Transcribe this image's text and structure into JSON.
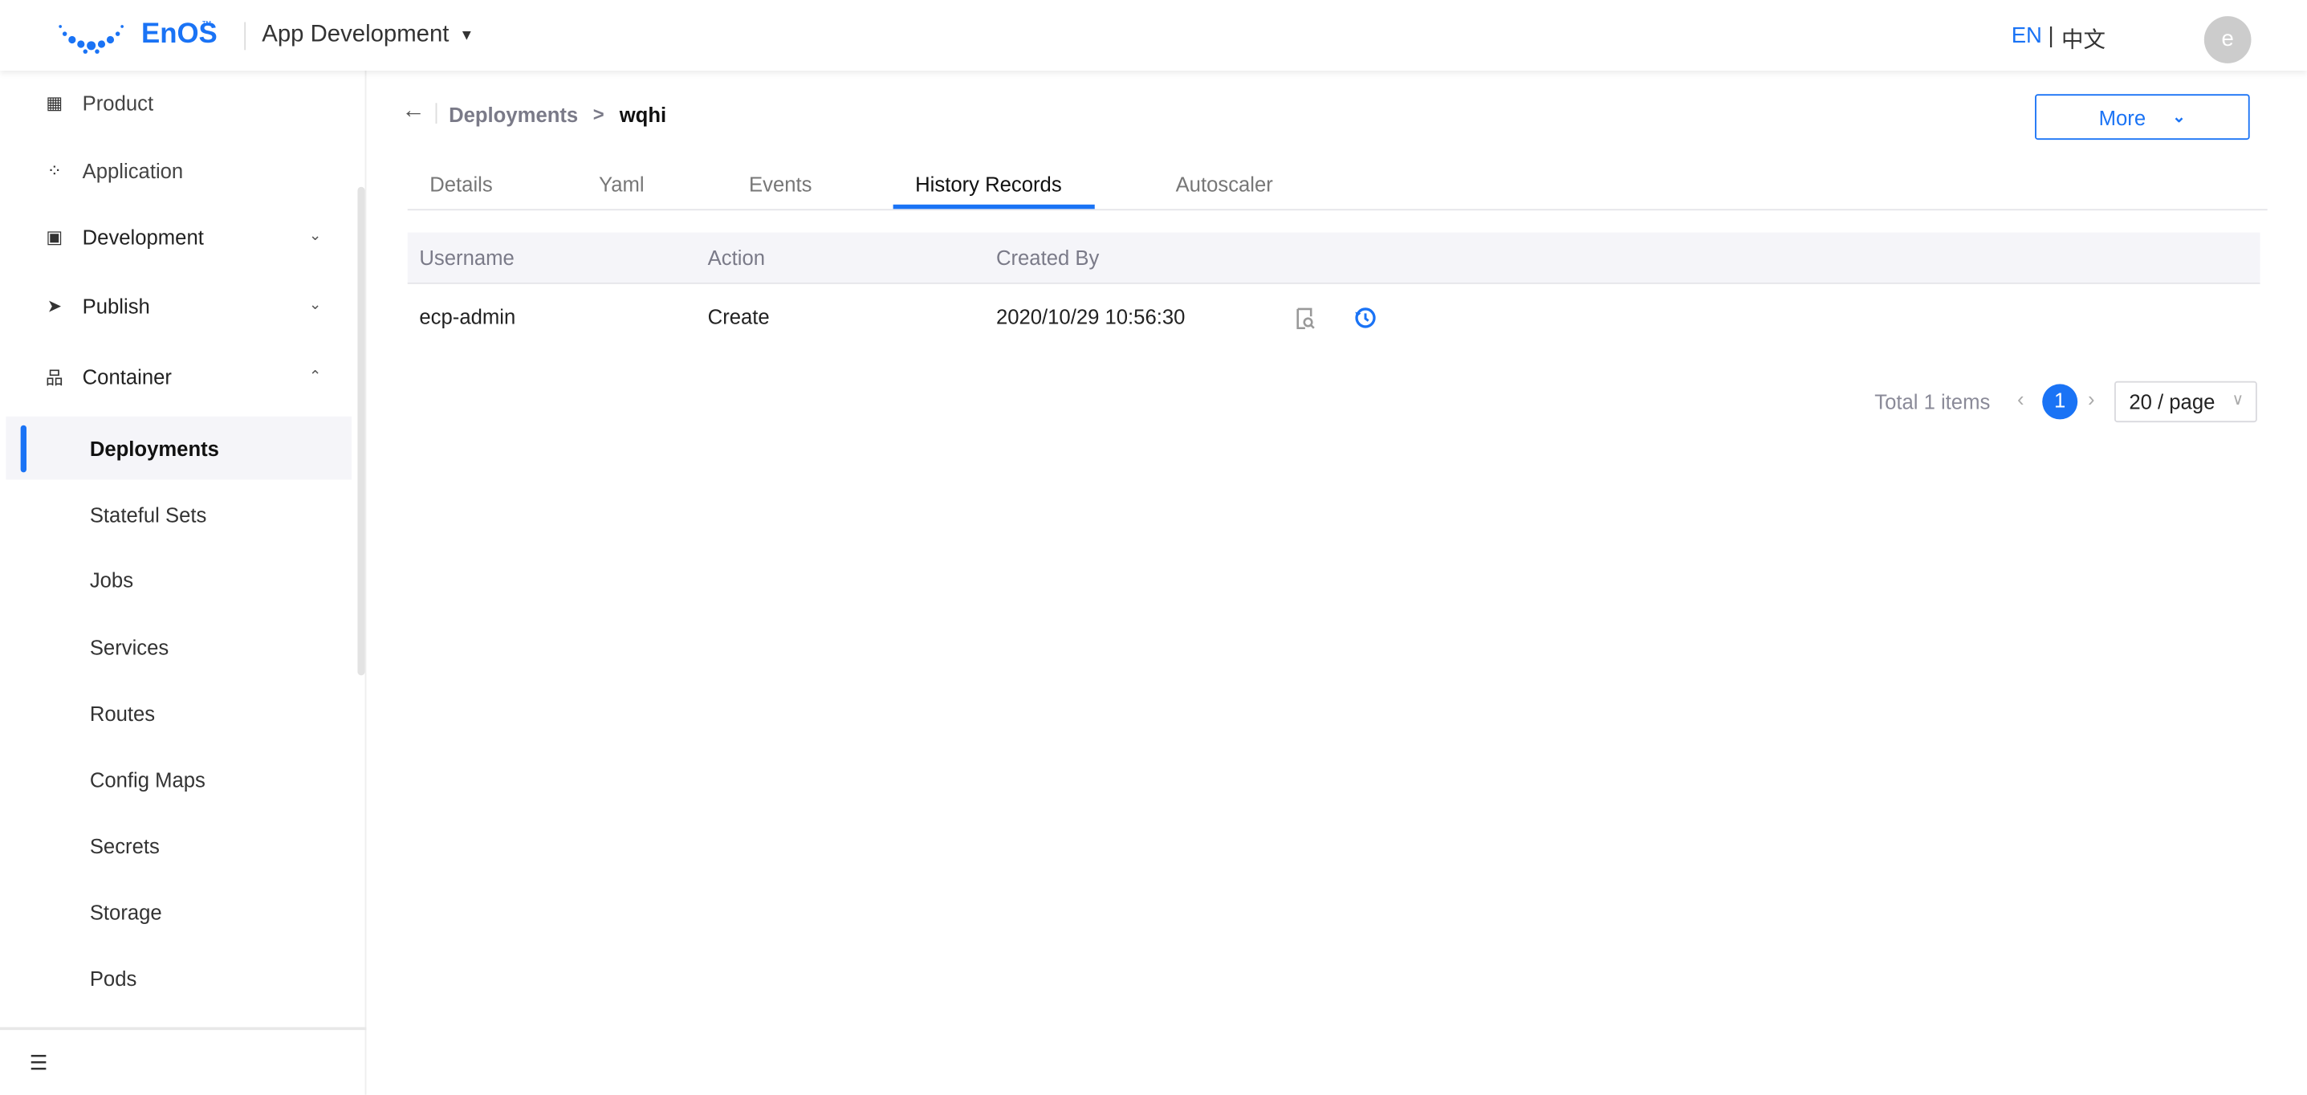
{
  "header": {
    "brand": "EnOS",
    "trademark": "™",
    "app_switcher": "App Development",
    "lang_en": "EN",
    "lang_sep": "|",
    "lang_zh": "中文",
    "avatar_initial": "e"
  },
  "sidebar": {
    "items": [
      {
        "label": "Product",
        "icon": "grid-icon"
      },
      {
        "label": "Application",
        "icon": "apps-add-icon"
      },
      {
        "label": "Development",
        "icon": "monitor-icon",
        "expanded": false
      },
      {
        "label": "Publish",
        "icon": "paper-plane-icon",
        "expanded": false
      },
      {
        "label": "Container",
        "icon": "sitemap-icon",
        "expanded": true
      }
    ],
    "sub_items": [
      "Deployments",
      "Stateful Sets",
      "Jobs",
      "Services",
      "Routes",
      "Config Maps",
      "Secrets",
      "Storage",
      "Pods"
    ],
    "selected": "Deployments"
  },
  "breadcrumb": {
    "parent": "Deployments",
    "sep": ">",
    "current": "wqhi"
  },
  "more_button": "More",
  "tabs": [
    "Details",
    "Yaml",
    "Events",
    "History Records",
    "Autoscaler"
  ],
  "active_tab": "History Records",
  "table": {
    "columns": [
      "Username",
      "Action",
      "Created By"
    ],
    "rows": [
      {
        "username": "ecp-admin",
        "action": "Create",
        "created": "2020/10/29 10:56:30"
      }
    ]
  },
  "pagination": {
    "total": "Total 1 items",
    "page": "1",
    "page_size": "20 / page"
  },
  "colors": {
    "accent": "#1a73f5",
    "header_bg": "#f5f5f9"
  }
}
